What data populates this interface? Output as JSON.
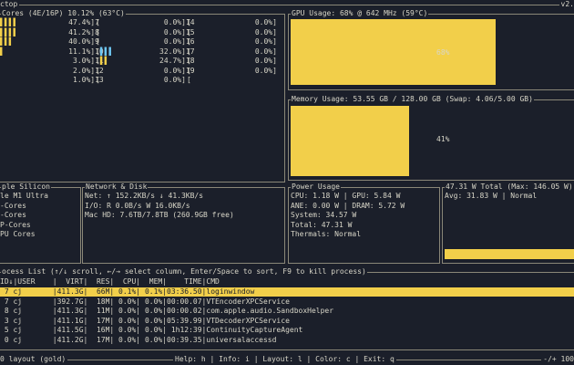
{
  "app": {
    "title_fragment": "ctop",
    "version_fragment": "v2."
  },
  "cpu": {
    "title": "Cores (4E/16P) 10.12% (63°C)",
    "col1": [
      {
        "bar": "▌▌▌▌",
        "pct": "47.4%",
        "idx": "7"
      },
      {
        "bar": "▌▌▌▌",
        "pct": "41.2%",
        "idx": "8"
      },
      {
        "bar": "▌▌▌",
        "pct": "40.0%",
        "idx": "9"
      },
      {
        "bar": "▌",
        "pct": "11.1%",
        "idx": "10"
      },
      {
        "bar": "",
        "pct": "3.0%",
        "idx": "11"
      },
      {
        "bar": "",
        "pct": "2.0%",
        "idx": "12"
      },
      {
        "bar": "",
        "pct": "1.0%",
        "idx": "13"
      }
    ],
    "col2": [
      {
        "bar": "",
        "pct": "0.0%",
        "idx": "14"
      },
      {
        "bar": "",
        "pct": "0.0%",
        "idx": "15"
      },
      {
        "bar": "",
        "pct": "0.0%",
        "idx": "16"
      },
      {
        "bar": "▌▌▌",
        "pct": "32.0%",
        "idx": "17",
        "color": "b"
      },
      {
        "bar": "▌▌",
        "pct": "24.7%",
        "idx": "18"
      },
      {
        "bar": "",
        "pct": "0.0%",
        "idx": "19"
      },
      {
        "bar": "",
        "pct": "0.0%",
        "idx": ""
      }
    ],
    "col3": [
      {
        "bar": "",
        "pct": "0.0%"
      },
      {
        "bar": "",
        "pct": "0.0%"
      },
      {
        "bar": "",
        "pct": "0.0%"
      },
      {
        "bar": "",
        "pct": "0.0%"
      },
      {
        "bar": "",
        "pct": "0.0%"
      },
      {
        "bar": "",
        "pct": "0.0%"
      },
      {
        "bar": "",
        "pct": ""
      }
    ]
  },
  "gpu": {
    "title": "GPU Usage: 68% @ 642 MHz (59°C)",
    "label": "68%",
    "fraction": 0.68
  },
  "memory": {
    "title": "Memory Usage: 53.55 GB / 128.00 GB (Swap: 4.06/5.00 GB)",
    "label": "41%",
    "fraction": 0.41
  },
  "silicon": {
    "title": "ple Silicon",
    "lines": [
      "le M1 Ultra",
      "-Cores",
      "-Cores",
      "P-Cores",
      "PU Cores"
    ]
  },
  "network": {
    "title": "Network & Disk",
    "lines": [
      "Net: ↑ 152.2KB/s ↓ 41.3KB/s",
      "I/O: R 0.0B/s W 16.0KB/s",
      "Mac HD: 7.6TB/7.8TB (260.9GB free)"
    ]
  },
  "power": {
    "title": "Power Usage",
    "lines": [
      "CPU: 1.18 W | GPU: 5.84 W",
      "ANE: 0.00 W | DRAM: 5.72 W",
      "System: 34.57 W",
      "Total: 47.31 W",
      "Thermals: Normal"
    ]
  },
  "power_total": {
    "title": "47.31 W Total (Max: 146.05 W)",
    "avg": "Avg: 31.83 W | Normal"
  },
  "processes": {
    "title": "ocess List (↑/↓ scroll, ←/→ select column, Enter/Space to sort, F9 to kill process)",
    "header": "ID↓|USER    |  VIRT|  RES|  CPU|  MEM|    TIME|CMD",
    "rows": [
      {
        "pid": "7",
        "user": "cj",
        "virt": "411.3G",
        "res": "66M",
        "cpu": "0.1%",
        "mem": "0.1%",
        "time": "03:36.50",
        "cmd": "loginwindow"
      },
      {
        "pid": "7",
        "user": "cj",
        "virt": "392.7G",
        "res": "18M",
        "cpu": "0.0%",
        "mem": "0.0%",
        "time": "00:00.07",
        "cmd": "VTEncoderXPCService"
      },
      {
        "pid": "8",
        "user": "cj",
        "virt": "411.3G",
        "res": "11M",
        "cpu": "0.0%",
        "mem": "0.0%",
        "time": "00:00.02",
        "cmd": "com.apple.audio.SandboxHelper"
      },
      {
        "pid": "3",
        "user": "cj",
        "virt": "411.1G",
        "res": "17M",
        "cpu": "0.0%",
        "mem": "0.0%",
        "time": "05:39.99",
        "cmd": "VTDecoderXPCService"
      },
      {
        "pid": "5",
        "user": "cj",
        "virt": "411.5G",
        "res": "16M",
        "cpu": "0.0%",
        "mem": "0.0%",
        "time": "1h12:39",
        "cmd": "ContinuityCaptureAgent"
      },
      {
        "pid": "0",
        "user": "cj",
        "virt": "411.2G",
        "res": "17M",
        "cpu": "0.0%",
        "mem": "0.0%",
        "time": "00:39.35",
        "cmd": "universalaccessd"
      }
    ]
  },
  "footer": {
    "left": "0 layout (gold)",
    "help": "Help: h | Info: i | Layout: l | Color: c | Exit: q",
    "right": "-/+ 100"
  }
}
